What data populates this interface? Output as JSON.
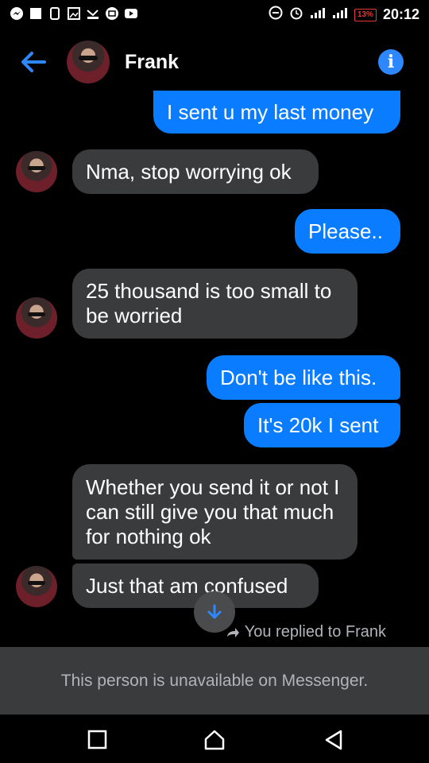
{
  "status": {
    "battery": "13%",
    "time": "20:12"
  },
  "header": {
    "name": "Frank"
  },
  "messages": [
    {
      "text": "I sent u my last money"
    },
    {
      "text": "Nma, stop worrying ok"
    },
    {
      "text": "Please.."
    },
    {
      "text": "25 thousand is too small to be worried"
    },
    {
      "text": "Don't be like this."
    },
    {
      "text": "It's 20k I sent"
    },
    {
      "text": "Whether you send it or not I can still give you that much for nothing ok"
    },
    {
      "text": "Just that am confused"
    }
  ],
  "reply_note": "You replied to Frank",
  "unavailable_text": "This person is unavailable on Messenger.",
  "colors": {
    "outgoing": "#0a7cff",
    "incoming": "#3a3b3c",
    "accent": "#2d88ff"
  }
}
